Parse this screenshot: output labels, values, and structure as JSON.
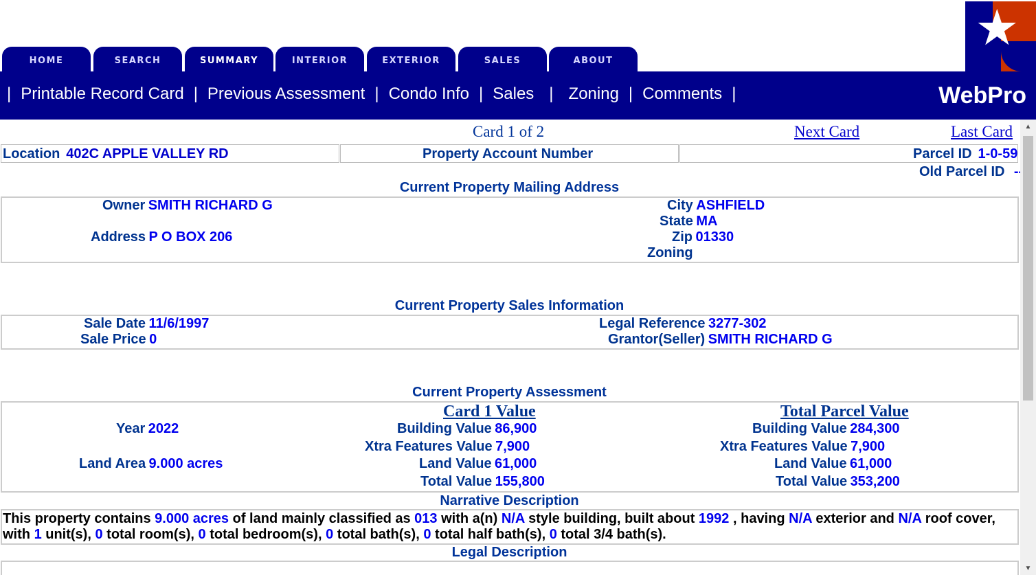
{
  "tabs": [
    {
      "label": "HOME"
    },
    {
      "label": "SEARCH"
    },
    {
      "label": "SUMMARY"
    },
    {
      "label": "INTERIOR"
    },
    {
      "label": "EXTERIOR"
    },
    {
      "label": "SALES"
    },
    {
      "label": "ABOUT"
    }
  ],
  "nav": {
    "printable": "Printable Record Card",
    "previous": "Previous Assessment",
    "condo": "Condo Info",
    "sales": "Sales",
    "zoning": "Zoning",
    "comments": "Comments",
    "sep": "|",
    "brand": "WebPro"
  },
  "card": {
    "label": "Card 1 of 2",
    "next": "Next Card",
    "last": "Last Card"
  },
  "header": {
    "location_label": "Location",
    "location_value": "402C APPLE VALLEY RD",
    "account_label": "Property Account Number",
    "parcel_label": "Parcel ID",
    "parcel_value": "1-0-59",
    "old_parcel_label": "Old Parcel ID",
    "old_parcel_value": "--"
  },
  "mailing": {
    "title": "Current Property Mailing Address",
    "owner_label": "Owner",
    "owner_value": "SMITH RICHARD G",
    "address_label": "Address",
    "address_value": "P O BOX 206",
    "city_label": "City",
    "city_value": "ASHFIELD",
    "state_label": "State",
    "state_value": "MA",
    "zip_label": "Zip",
    "zip_value": "01330",
    "zoning_label": "Zoning"
  },
  "sales": {
    "title": "Current Property Sales Information",
    "date_label": "Sale Date",
    "date_value": "11/6/1997",
    "price_label": "Sale Price",
    "price_value": "0",
    "legal_label": "Legal Reference",
    "legal_value": "3277-302",
    "grantor_label": "Grantor(Seller)",
    "grantor_value": "SMITH RICHARD G"
  },
  "assessment": {
    "title": "Current Property Assessment",
    "card_heading": "Card 1 Value",
    "total_heading": "Total Parcel Value",
    "year_label": "Year",
    "year_value": "2022",
    "land_area_label": "Land Area",
    "land_area_value": "9.000 acres",
    "building_label": "Building Value",
    "xtra_label": "Xtra Features Value",
    "land_label": "Land Value",
    "total_label": "Total Value",
    "card_building": "86,900",
    "card_xtra": "7,900",
    "card_land": "61,000",
    "card_total": "155,800",
    "parcel_building": "284,300",
    "parcel_xtra": "7,900",
    "parcel_land": "61,000",
    "parcel_total": "353,200"
  },
  "narrative": {
    "title": "Narrative Description",
    "t1": "This property contains",
    "acres": "9.000 acres",
    "t2": "of land mainly classified as",
    "class": "013",
    "t3": "with a(n)",
    "style": "N/A",
    "t4": "style building, built about",
    "year": "1992",
    "t5": ", having",
    "exterior": "N/A",
    "t6": "exterior and",
    "roof": "N/A",
    "t7": "roof cover, with",
    "units": "1",
    "t8": "unit(s),",
    "rooms": "0",
    "t9": "total room(s),",
    "bedrooms": "0",
    "t10": "total bedroom(s),",
    "baths": "0",
    "t11": "total bath(s),",
    "halfbaths": "0",
    "t12": "total half bath(s),",
    "qbaths": "0",
    "t13": "total 3/4 bath(s)."
  },
  "legal": {
    "title": "Legal Description"
  }
}
